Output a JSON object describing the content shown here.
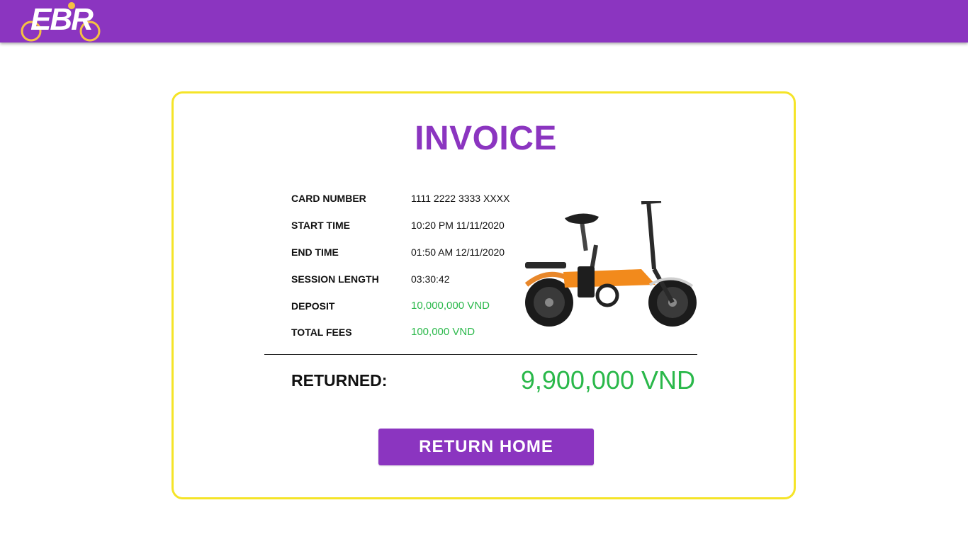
{
  "header": {
    "logo_text": "EBR",
    "brand_color": "#8b35c0",
    "accent_color": "#f5c242"
  },
  "invoice": {
    "title": "INVOICE",
    "rows": [
      {
        "label": "CARD NUMBER",
        "value": "1111 2222 3333 XXXX"
      },
      {
        "label": "START TIME",
        "value": "10:20 PM 11/11/2020"
      },
      {
        "label": "END TIME",
        "value": "01:50 AM 12/11/2020"
      },
      {
        "label": "SESSION LENGTH",
        "value": "03:30:42"
      },
      {
        "label": "DEPOSIT",
        "value": "10,000,000 VND"
      },
      {
        "label": "TOTAL FEES",
        "value": "100,000 VND"
      }
    ],
    "returned_label": "RETURNED:",
    "returned_value": "9,900,000 VND",
    "bike_image": "orange-folding-ebike",
    "border_color": "#f5e428",
    "money_color": "#2ab84a"
  },
  "actions": {
    "return_home_label": "RETURN HOME"
  }
}
